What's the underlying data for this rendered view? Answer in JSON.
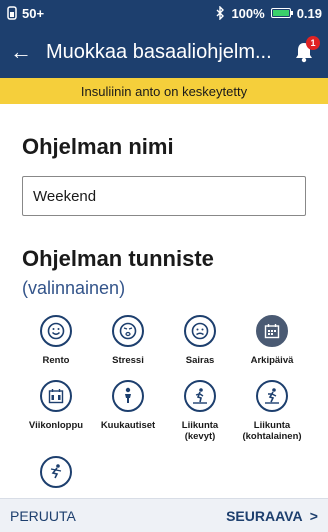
{
  "status_bar": {
    "left_text": "50+",
    "battery_percent": "100%",
    "right_value": "0.19"
  },
  "app_bar": {
    "title": "Muokkaa basaaliohjelm...",
    "notification_count": "1"
  },
  "banner": {
    "text": "Insuliinin anto on keskeytetty"
  },
  "program_name": {
    "heading": "Ohjelman nimi",
    "value": "Weekend"
  },
  "program_tag": {
    "heading": "Ohjelman tunniste",
    "optional": "(valinnainen)",
    "tags": [
      {
        "label": "Rento",
        "icon": "smile-icon",
        "selected": false
      },
      {
        "label": "Stressi",
        "icon": "stress-icon",
        "selected": false
      },
      {
        "label": "Sairas",
        "icon": "sick-icon",
        "selected": false
      },
      {
        "label": "Arkipäivä",
        "icon": "calendar-icon",
        "selected": true
      },
      {
        "label": "Viikonloppu",
        "icon": "calendar-weekend-icon",
        "selected": false
      },
      {
        "label": "Kuukautiset",
        "icon": "person-icon",
        "selected": false
      },
      {
        "label": "Liikunta (kevyt)",
        "icon": "exercise-light-icon",
        "selected": false
      },
      {
        "label": "Liikunta (kohtalainen)",
        "icon": "exercise-moderate-icon",
        "selected": false
      },
      {
        "label": "",
        "icon": "exercise-intense-icon",
        "selected": false
      }
    ]
  },
  "footer": {
    "cancel_label": "PERUUTA",
    "next_label": "SEURAAVA"
  },
  "colors": {
    "primary": "#1d3f6e",
    "banner": "#f5cf3b",
    "badge": "#e02323"
  }
}
